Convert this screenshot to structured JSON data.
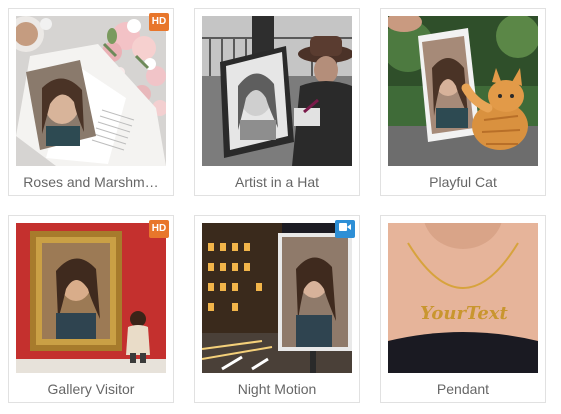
{
  "cards": [
    {
      "caption": "Roses and Marshm…",
      "badge": "HD",
      "badge_color": "#e8762b"
    },
    {
      "caption": "Artist in a Hat",
      "badge": "",
      "badge_color": ""
    },
    {
      "caption": "Playful Cat",
      "badge": "",
      "badge_color": ""
    },
    {
      "caption": "Gallery Visitor",
      "badge": "HD",
      "badge_color": "#e8762b"
    },
    {
      "caption": "Night Motion",
      "badge": "video",
      "badge_color": "#2d8fd6"
    },
    {
      "caption": "Pendant",
      "badge": "",
      "badge_color": ""
    }
  ],
  "pendant_text": "YourText"
}
